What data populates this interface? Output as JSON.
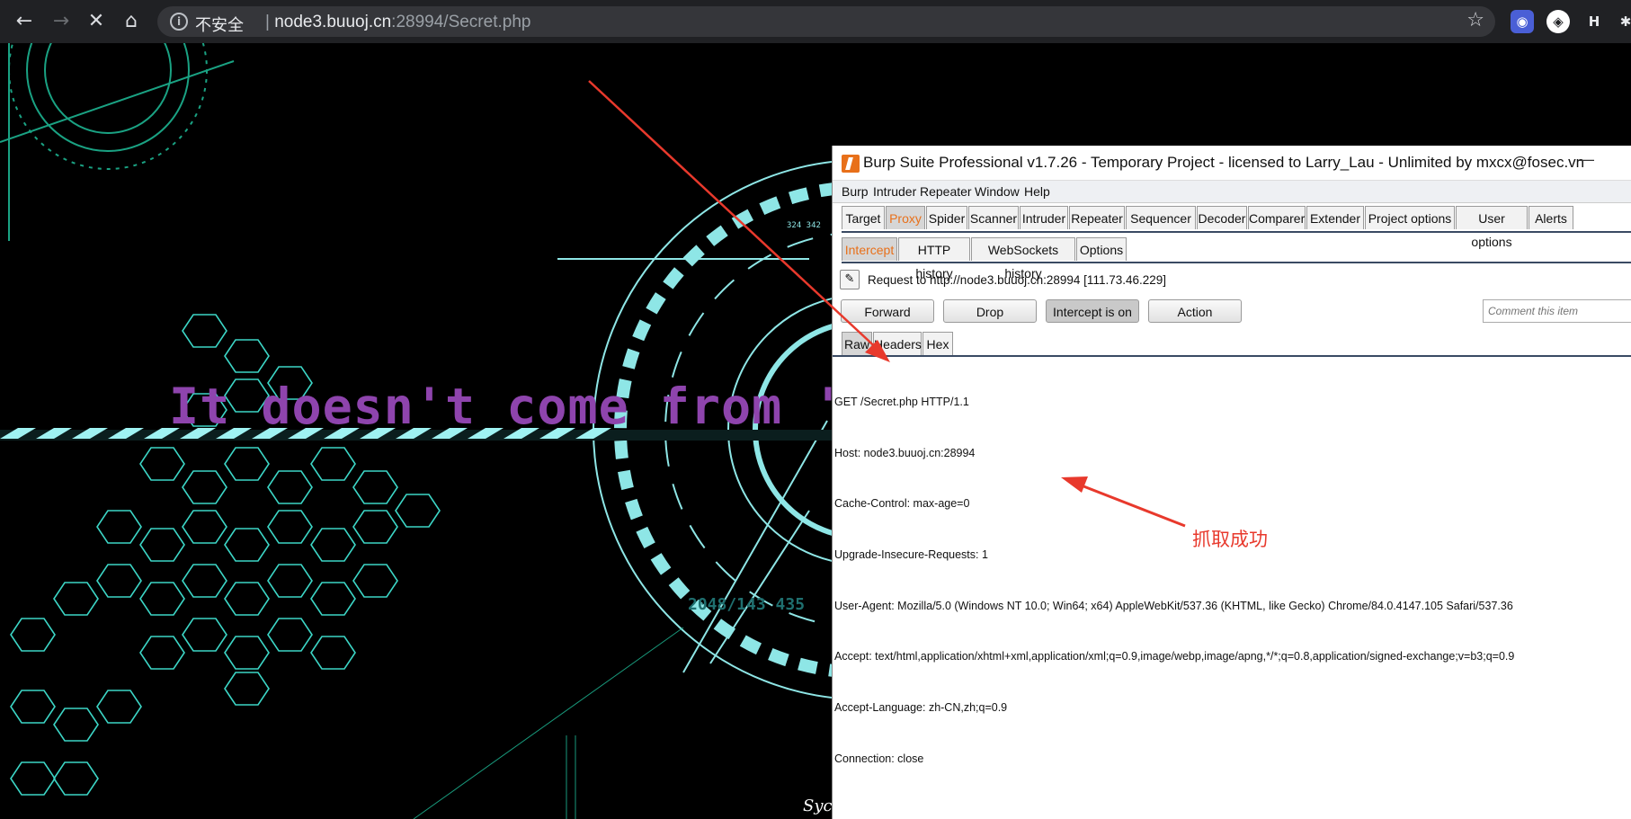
{
  "browser": {
    "insecure_label": "不安全",
    "separator": "|",
    "url_host": "node3.buuoj.cn",
    "url_rest": ":28994/Secret.php",
    "ext_h": "H"
  },
  "page": {
    "headline": "It doesn't come from 'h",
    "corner_text": "Syc",
    "overlay_numbers": "324 342",
    "overlay_numbers2": "2048/143 435"
  },
  "burp": {
    "title": "Burp Suite Professional v1.7.26 - Temporary Project - licensed to Larry_Lau - Unlimited by mxcx@fosec.vn",
    "minimize": "—",
    "menu": [
      "Burp",
      "Intruder",
      "Repeater",
      "Window",
      "Help"
    ],
    "tabs": [
      "Target",
      "Proxy",
      "Spider",
      "Scanner",
      "Intruder",
      "Repeater",
      "Sequencer",
      "Decoder",
      "Comparer",
      "Extender",
      "Project options",
      "User options",
      "Alerts"
    ],
    "subtabs": [
      "Intercept",
      "HTTP history",
      "WebSockets history",
      "Options"
    ],
    "request_to": "Request to http://node3.buuoj.cn:28994  [111.73.46.229]",
    "buttons": {
      "forward": "Forward",
      "drop": "Drop",
      "intercept": "Intercept is on",
      "action": "Action"
    },
    "comment_placeholder": "Comment this item",
    "view_tabs": [
      "Raw",
      "Headers",
      "Hex"
    ],
    "request_lines": [
      "GET /Secret.php HTTP/1.1",
      "Host: node3.buuoj.cn:28994",
      "Cache-Control: max-age=0",
      "Upgrade-Insecure-Requests: 1",
      "User-Agent: Mozilla/5.0 (Windows NT 10.0; Win64; x64) AppleWebKit/537.36 (KHTML, like Gecko) Chrome/84.0.4147.105 Safari/537.36",
      "Accept: text/html,application/xhtml+xml,application/xml;q=0.9,image/webp,image/apng,*/*;q=0.8,application/signed-exchange;v=b3;q=0.9",
      "Accept-Language: zh-CN,zh;q=0.9",
      "Connection: close"
    ]
  },
  "annotation": {
    "text": "抓取成功",
    "color": "#e8392c"
  }
}
